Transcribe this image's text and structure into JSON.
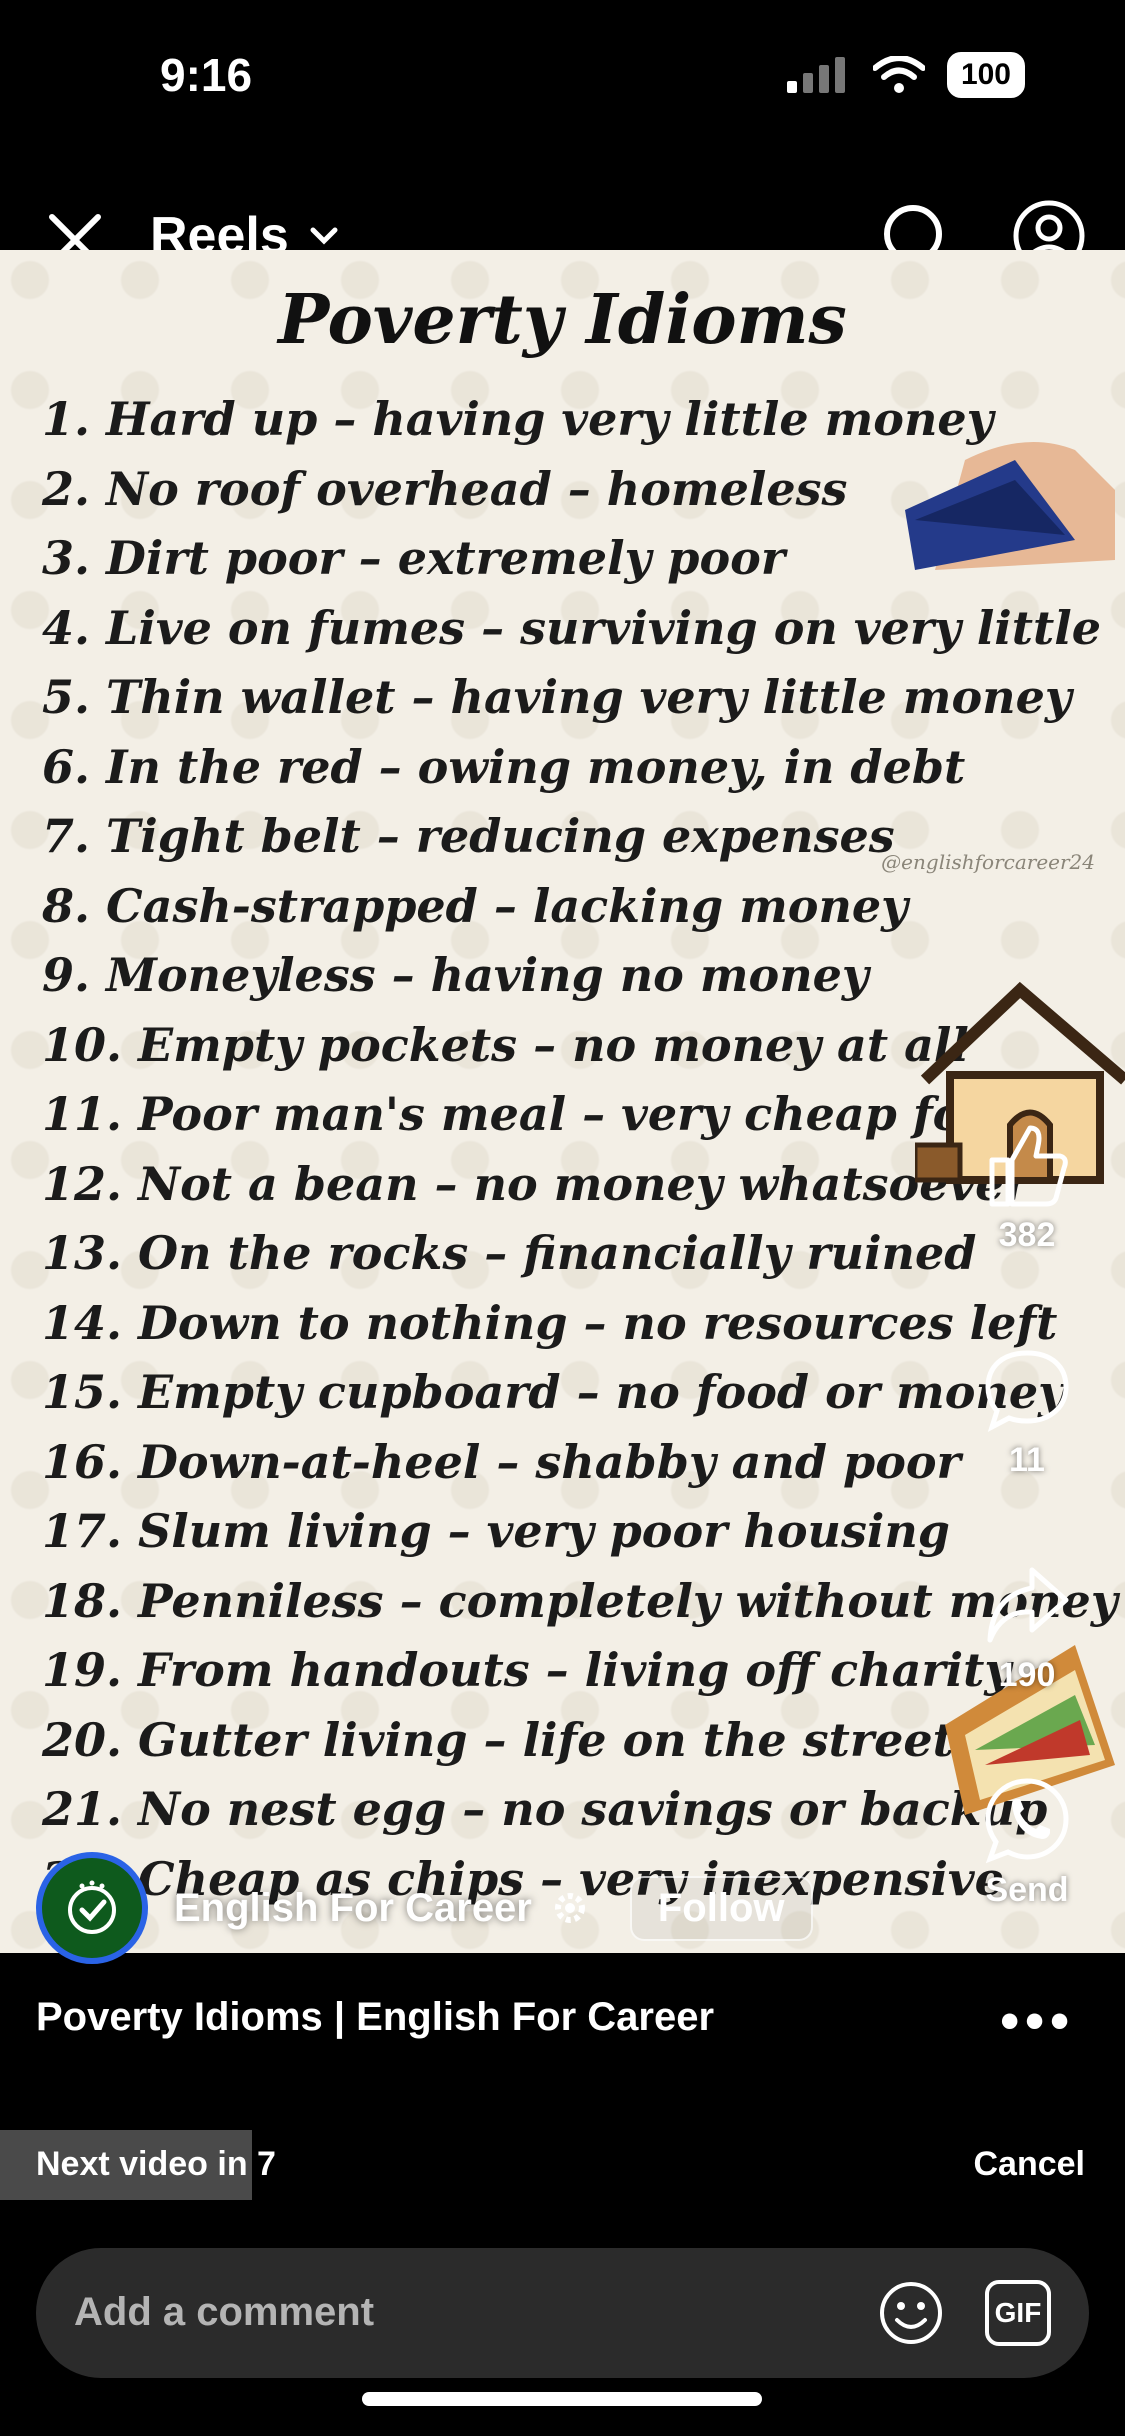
{
  "status_bar": {
    "time": "9:16",
    "battery": "100"
  },
  "header": {
    "title": "Reels"
  },
  "video": {
    "title": "Poverty Idioms",
    "watermark": "@englishforcareer24",
    "idioms": [
      "1. Hard up – having very little money",
      "2. No roof overhead – homeless",
      "3. Dirt poor – extremely poor",
      "4. Live on fumes – surviving on very little",
      "5. Thin wallet – having very little money",
      "6. In the red – owing money, in debt",
      "7. Tight belt – reducing expenses",
      "8. Cash-strapped – lacking money",
      "9. Moneyless – having no money",
      "10. Empty pockets – no money at all",
      "11. Poor man's meal – very cheap food",
      "12. Not a bean – no money whatsoever",
      "13. On the rocks – financially ruined",
      "14. Down to nothing – no resources left",
      "15. Empty cupboard – no food or money",
      "16. Down-at-heel – shabby and poor",
      "17. Slum living – very poor housing",
      "18. Penniless – completely without money",
      "19. From handouts – living off charity",
      "20. Gutter living – life on the streets",
      "21. No nest egg – no savings or backup",
      "22. Cheap as chips – very inexpensive"
    ]
  },
  "actions": {
    "likes": "382",
    "comments": "11",
    "shares": "190",
    "send": "Send"
  },
  "creator": {
    "name": "English For Career",
    "follow": "Follow"
  },
  "caption": "Poverty Idioms | English For Career",
  "next_video": {
    "text": "Next video in 7",
    "cancel": "Cancel"
  },
  "comment": {
    "placeholder": "Add a comment",
    "gif": "GIF"
  }
}
